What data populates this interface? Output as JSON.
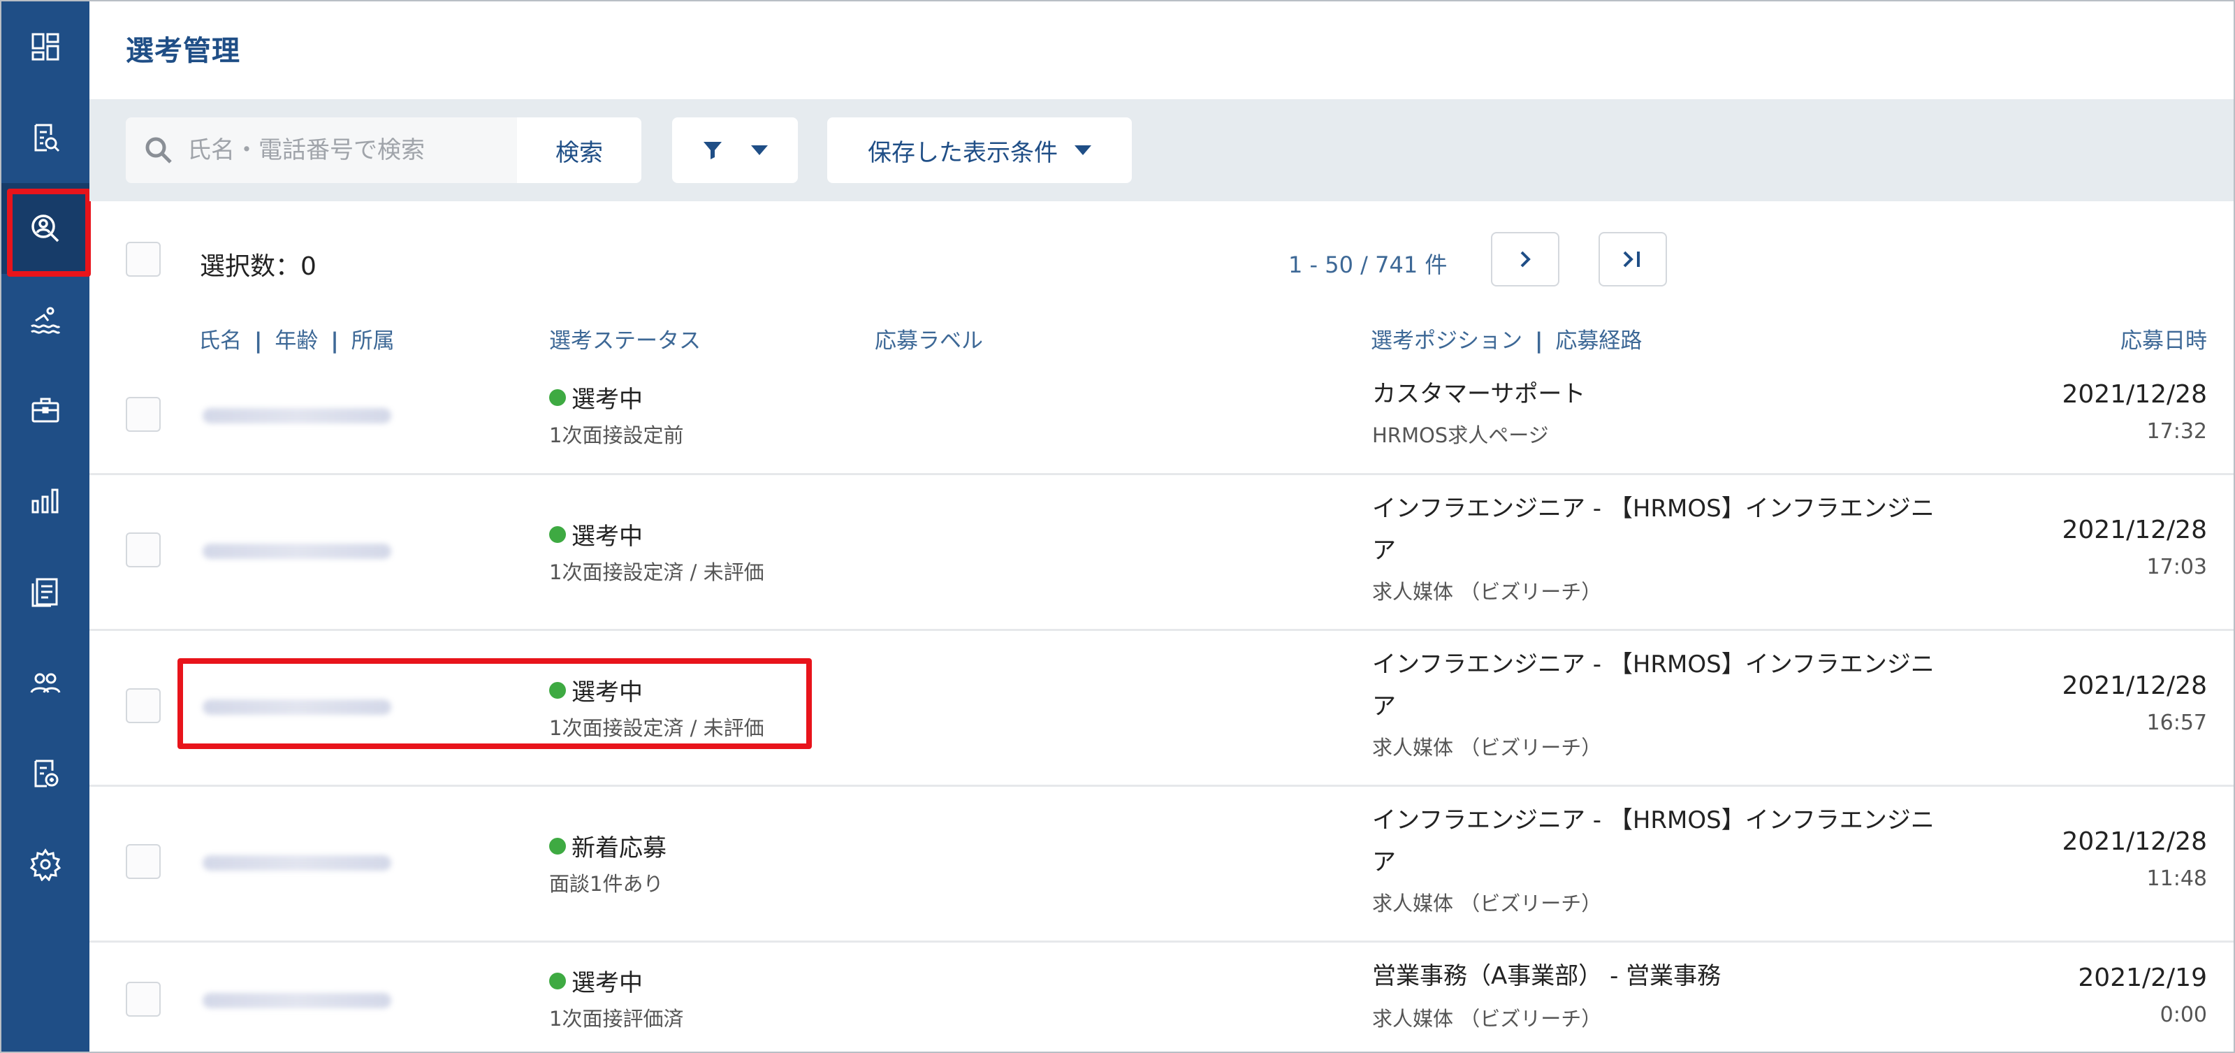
{
  "header": {
    "title": "選考管理"
  },
  "toolbar": {
    "search_placeholder": "氏名・電話番号で検索",
    "search_button": "検索",
    "saved_conditions": "保存した表示条件"
  },
  "list": {
    "selected_label": "選択数：0",
    "pagination": "1 - 50 / 741 件",
    "columns": {
      "name": "氏名",
      "age": "年齢",
      "affiliation": "所属",
      "status": "選考ステータス",
      "label": "応募ラベル",
      "position": "選考ポジション",
      "route": "応募経路",
      "date": "応募日時"
    },
    "rows": [
      {
        "status": "選考中",
        "sub": "1次面接設定前",
        "position": "カスタマーサポート",
        "route": "HRMOS求人ページ",
        "date": "2021/12/28",
        "time": "17:32"
      },
      {
        "status": "選考中",
        "sub": "1次面接設定済 / 未評価",
        "position": "インフラエンジニア - 【HRMOS】インフラエンジニア",
        "route": "求人媒体 （ビズリーチ）",
        "date": "2021/12/28",
        "time": "17:03"
      },
      {
        "status": "選考中",
        "sub": "1次面接設定済 / 未評価",
        "position": "インフラエンジニア - 【HRMOS】インフラエンジニア",
        "route": "求人媒体 （ビズリーチ）",
        "date": "2021/12/28",
        "time": "16:57"
      },
      {
        "status": "新着応募",
        "sub": "面談1件あり",
        "position": "インフラエンジニア - 【HRMOS】インフラエンジニア",
        "route": "求人媒体 （ビズリーチ）",
        "date": "2021/12/28",
        "time": "11:48"
      },
      {
        "status": "選考中",
        "sub": "1次面接評価済",
        "position": "営業事務（A事業部） - 営業事務",
        "route": "求人媒体 （ビズリーチ）",
        "date": "2021/2/19",
        "time": "0:00"
      }
    ]
  },
  "colors": {
    "sidebar": "#1f4e86",
    "accent": "#1f4e86",
    "status_dot": "#3eaa42",
    "highlight": "#e8141b"
  },
  "icons": [
    "dashboard-icon",
    "document-search-icon",
    "candidate-search-icon",
    "swimmer-icon",
    "briefcase-icon",
    "bar-chart-icon",
    "forms-icon",
    "people-icon",
    "document-settings-icon",
    "gear-icon"
  ]
}
